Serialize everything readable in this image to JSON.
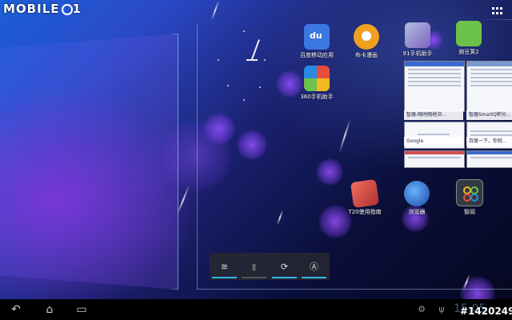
{
  "watermark": {
    "text": "MOBILE",
    "suffix": "1"
  },
  "apps": [
    {
      "label": "百度移动应用",
      "icon": "baidu-du-icon",
      "color": "#3a77e0"
    },
    {
      "label": "布卡漫画",
      "icon": "buka-mascot-icon",
      "color": "#f0a020"
    },
    {
      "label": "91手机助手",
      "icon": "91-assistant-icon",
      "color": "#8060c0"
    },
    {
      "label": "豌豆荚2",
      "icon": "wandoujia-icon",
      "color": "#6cc24a"
    },
    {
      "label": "360手机助手",
      "icon": "360-assistant-icon",
      "color": "#e84c3d"
    },
    {
      "label": "T20使用指南",
      "icon": "t20-guide-icon",
      "color": "#d04a3a"
    },
    {
      "label": "浏览器",
      "icon": "browser-globe-icon",
      "color": "#2a6bd0"
    },
    {
      "label": "智阅",
      "icon": "zhiyue-icon",
      "color": "#333a44"
    }
  ],
  "widgets": [
    {
      "label": "智器-随时随地浏..."
    },
    {
      "label": "智器SmartQ积分..."
    },
    {
      "label": "Google"
    },
    {
      "label": "百度一下，你就..."
    }
  ],
  "toggles": [
    {
      "name": "wifi",
      "icon": "wifi-icon",
      "glyph": "≋",
      "on": true
    },
    {
      "name": "battery",
      "icon": "battery-icon",
      "glyph": "▮",
      "on": false
    },
    {
      "name": "sync",
      "icon": "sync-icon",
      "glyph": "⟳",
      "on": true
    },
    {
      "name": "auto-brightness",
      "icon": "brightness-auto-icon",
      "glyph": "Ⓐ",
      "on": true
    }
  ],
  "navbar": {
    "back": "↶",
    "home": "⌂",
    "recent": "▭"
  },
  "statusbar": {
    "time": "15:05",
    "android_glyph": "⚙",
    "usb_glyph": "ψ"
  },
  "photo_id": "#1420249"
}
